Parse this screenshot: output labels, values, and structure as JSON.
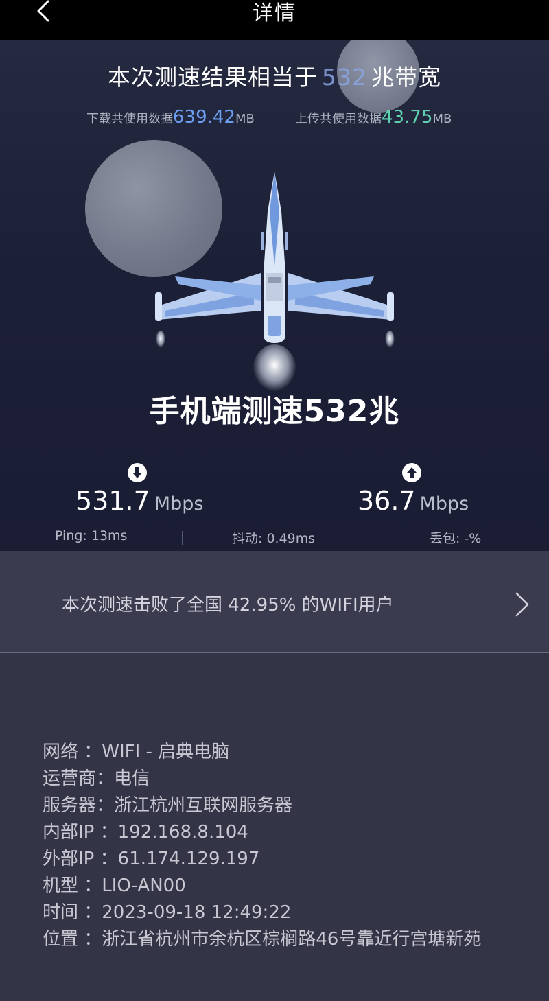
{
  "topbar": {
    "title": "详情",
    "back_icon": "chevron-left-icon"
  },
  "summary": {
    "prefix": "本次测速结果相当于",
    "value": "532",
    "suffix": "兆带宽",
    "download_label": "下载共使用数据",
    "download_value": "639.42",
    "download_unit": "MB",
    "upload_label": "上传共使用数据",
    "upload_value": "43.75",
    "upload_unit": "MB"
  },
  "headline": "手机端测速532兆",
  "speeds": {
    "download_value": "531.7",
    "download_unit": "Mbps",
    "upload_value": "36.7",
    "upload_unit": "Mbps"
  },
  "metrics": {
    "ping": "Ping:  13ms",
    "jitter": "抖动:  0.49ms",
    "loss": "丢包:  -%"
  },
  "banner": {
    "text": "本次测速击败了全国 42.95% 的WIFI用户"
  },
  "details": [
    {
      "key": "网络 ：",
      "value": "WIFI - 启典电脑"
    },
    {
      "key": "运营商：",
      "value": "电信"
    },
    {
      "key": "服务器：",
      "value": "浙江杭州互联网服务器"
    },
    {
      "key": "内部IP ：",
      "value": "192.168.8.104"
    },
    {
      "key": "外部IP ：",
      "value": "61.174.129.197"
    },
    {
      "key": "机型 ：",
      "value": "LIO-AN00"
    },
    {
      "key": "时间 ：",
      "value": "2023-09-18 12:49:22"
    },
    {
      "key": "位置 ：",
      "value": "浙江省杭州市余杭区棕榈路46号靠近行宫塘新苑"
    }
  ],
  "colors": {
    "download_accent": "#6b9df0",
    "upload_accent": "#5fd3b1"
  }
}
